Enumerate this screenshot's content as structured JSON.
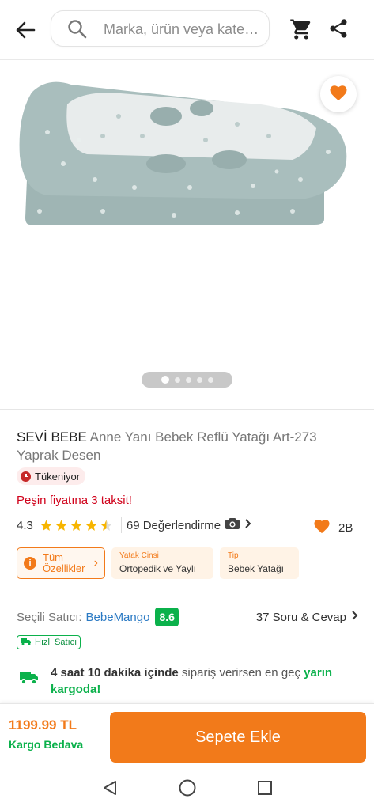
{
  "header": {
    "search_placeholder": "Marka, ürün veya kate…"
  },
  "gallery": {
    "dots_total": 5,
    "active_dot": 1
  },
  "product": {
    "brand": "SEVİ BEBE",
    "name": " Anne Yanı Bebek Reflü Yatağı Art-273 Yaprak Desen",
    "stock_badge": "Tükeniyor",
    "installments": "Peşin fiyatına 3 taksit!",
    "rating": "4.3",
    "reviews": "69 Değerlendirme",
    "likes": "2B"
  },
  "chips": {
    "all_features_line1": "Tüm",
    "all_features_line2": "Özellikler",
    "features": [
      {
        "key": "Yatak Cinsi",
        "value": "Ortopedik ve Yaylı"
      },
      {
        "key": "Tip",
        "value": "Bebek Yatağı"
      }
    ]
  },
  "seller": {
    "label": "Seçili Satıcı:",
    "name": "BebeMango",
    "score": "8.6",
    "qa": "37 Soru & Cevap",
    "fast_badge": "Hızlı Satıcı"
  },
  "delivery": {
    "part1": "4 saat 10 dakika içinde",
    "part2": " sipariş verirsen en geç ",
    "part3": "yarın kargoda!"
  },
  "footer": {
    "price": "1199.99 TL",
    "shipping": "Kargo Bedava",
    "add_to_cart": "Sepete Ekle"
  },
  "colors": {
    "accent": "#f27a1a",
    "green": "#0bb14b",
    "link": "#2b7ac4",
    "red": "#d0021b"
  }
}
